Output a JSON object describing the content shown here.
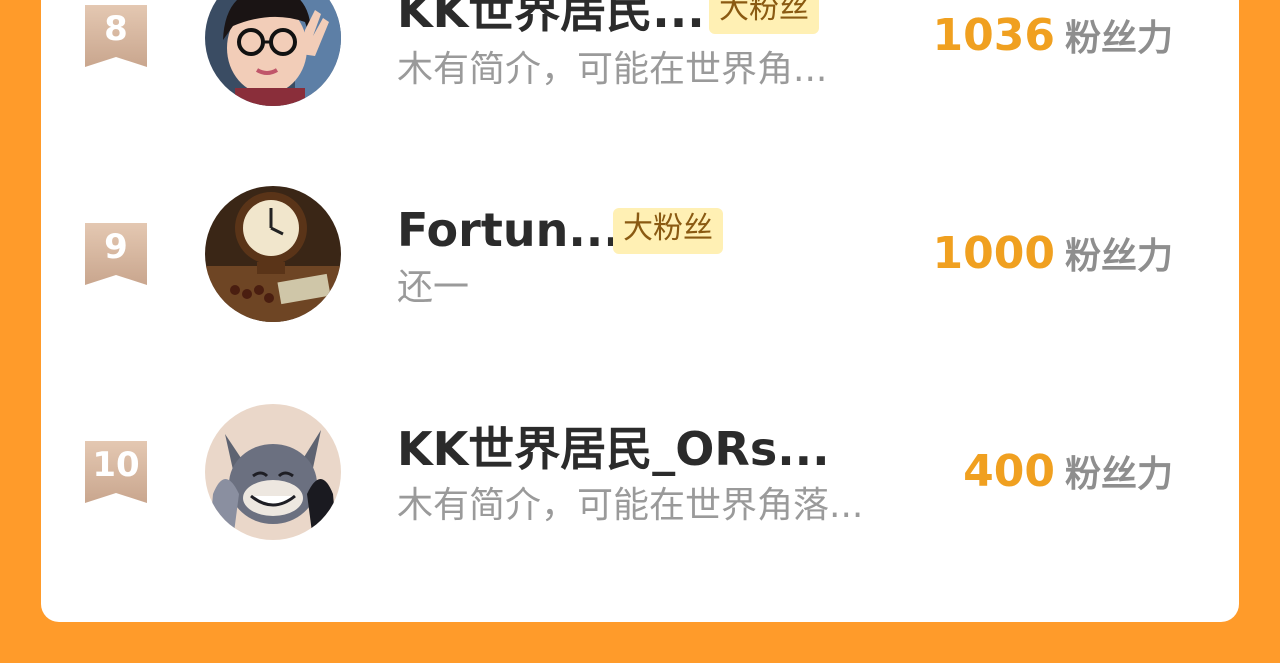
{
  "colors": {
    "background": "#FF9B2A",
    "card": "#FFFFFF",
    "score": "#F0A020",
    "badge_bg": "#FFF0B4"
  },
  "ranking": [
    {
      "rank": "8",
      "name": "KK世界居民...",
      "badge": "大粉丝",
      "bio": "木有简介，可能在世界角...",
      "score": "1036",
      "unit": "粉丝力",
      "avatar": "girl-with-glasses-photo"
    },
    {
      "rank": "9",
      "name": "Fortun...",
      "badge": "大粉丝",
      "bio": "还一",
      "score": "1000",
      "unit": "粉丝力",
      "avatar": "antique-clock-photo"
    },
    {
      "rank": "10",
      "name": "KK世界居民_ORs...",
      "badge": "",
      "bio": "木有简介，可能在世界角落...",
      "score": "400",
      "unit": "粉丝力",
      "avatar": "cartoon-cat-photo"
    }
  ]
}
